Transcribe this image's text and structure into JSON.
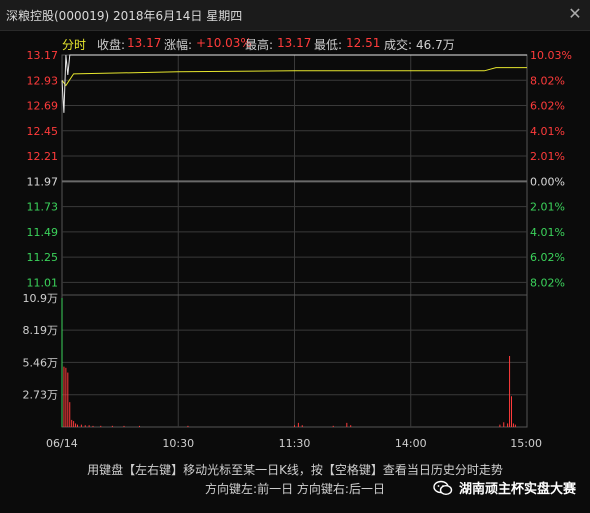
{
  "window": {
    "title": "深粮控股(000019) 2018年6月14日 星期四",
    "close_glyph": "✕"
  },
  "info": {
    "tab": "分时",
    "close_label": "收盘:",
    "close_value": "13.17",
    "change_label": "涨幅:",
    "change_value": "+10.03%",
    "high_label": "最高:",
    "high_value": "13.17",
    "low_label": "最低:",
    "low_value": "12.51",
    "volume_label": "成交:",
    "volume_value": "46.7万"
  },
  "colors": {
    "up": "#ff3b3b",
    "down": "#3bd35b",
    "price_line": "#e8e8e8",
    "avg_line": "#e6e62e",
    "grid": "#3a3a3a",
    "flat": "#d9d9d9"
  },
  "chart_data": {
    "type": "line",
    "title": "",
    "x_ticks": [
      "06/14",
      "10:30",
      "11:30",
      "14:00",
      "15:00"
    ],
    "price_ticks": [
      {
        "price": "13.17",
        "pct": "10.03%",
        "side": "up"
      },
      {
        "price": "12.93",
        "pct": "8.02%",
        "side": "up"
      },
      {
        "price": "12.69",
        "pct": "6.02%",
        "side": "up"
      },
      {
        "price": "12.45",
        "pct": "4.01%",
        "side": "up"
      },
      {
        "price": "12.21",
        "pct": "2.01%",
        "side": "up"
      },
      {
        "price": "11.97",
        "pct": "0.00%",
        "side": "flat"
      },
      {
        "price": "11.73",
        "pct": "2.01%",
        "side": "down"
      },
      {
        "price": "11.49",
        "pct": "4.01%",
        "side": "down"
      },
      {
        "price": "11.25",
        "pct": "6.02%",
        "side": "down"
      },
      {
        "price": "11.01",
        "pct": "8.02%",
        "side": "down"
      }
    ],
    "volume_ticks": [
      "10.9万",
      "8.19万",
      "5.46万",
      "2.73万"
    ],
    "price_range": [
      10.89,
      13.17
    ],
    "volume_range": [
      0,
      10.9
    ],
    "price_series": [
      {
        "t": 0,
        "v": 12.93
      },
      {
        "t": 1,
        "v": 12.62
      },
      {
        "t": 2,
        "v": 13.17
      },
      {
        "t": 3,
        "v": 12.98
      },
      {
        "t": 4,
        "v": 13.17
      },
      {
        "t": 240,
        "v": 13.17
      }
    ],
    "avg_series": [
      {
        "t": 0,
        "v": 12.93
      },
      {
        "t": 2,
        "v": 12.88
      },
      {
        "t": 6,
        "v": 12.99
      },
      {
        "t": 60,
        "v": 13.01
      },
      {
        "t": 120,
        "v": 13.02
      },
      {
        "t": 180,
        "v": 13.02
      },
      {
        "t": 218,
        "v": 13.02
      },
      {
        "t": 224,
        "v": 13.05
      },
      {
        "t": 240,
        "v": 13.05
      }
    ],
    "volume_bars": [
      {
        "t": 0,
        "v": 10.9
      },
      {
        "t": 1,
        "v": 5.1
      },
      {
        "t": 2,
        "v": 5.0
      },
      {
        "t": 3,
        "v": 4.6
      },
      {
        "t": 4,
        "v": 2.1
      },
      {
        "t": 5,
        "v": 0.6
      },
      {
        "t": 6,
        "v": 0.5
      },
      {
        "t": 7,
        "v": 0.3
      },
      {
        "t": 8,
        "v": 0.2
      },
      {
        "t": 10,
        "v": 0.2
      },
      {
        "t": 12,
        "v": 0.15
      },
      {
        "t": 14,
        "v": 0.15
      },
      {
        "t": 16,
        "v": 0.1
      },
      {
        "t": 20,
        "v": 0.1
      },
      {
        "t": 26,
        "v": 0.1
      },
      {
        "t": 32,
        "v": 0.1
      },
      {
        "t": 40,
        "v": 0.1
      },
      {
        "t": 65,
        "v": 0.1
      },
      {
        "t": 120,
        "v": 0.15
      },
      {
        "t": 122,
        "v": 0.35
      },
      {
        "t": 124,
        "v": 0.15
      },
      {
        "t": 140,
        "v": 0.1
      },
      {
        "t": 147,
        "v": 0.35
      },
      {
        "t": 149,
        "v": 0.15
      },
      {
        "t": 226,
        "v": 0.2
      },
      {
        "t": 228,
        "v": 0.4
      },
      {
        "t": 230,
        "v": 0.3
      },
      {
        "t": 231,
        "v": 6.0
      },
      {
        "t": 232,
        "v": 2.6
      },
      {
        "t": 233,
        "v": 0.3
      },
      {
        "t": 234,
        "v": 0.2
      }
    ]
  },
  "hints": {
    "line1": "用键盘【左右键】移动光标至某一日K线，按【空格键】查看当日历史分时走势",
    "line2": "方向键左:前一日  方向键右:后一日"
  },
  "watermark": {
    "text": "湖南顽主杯实盘大赛"
  }
}
